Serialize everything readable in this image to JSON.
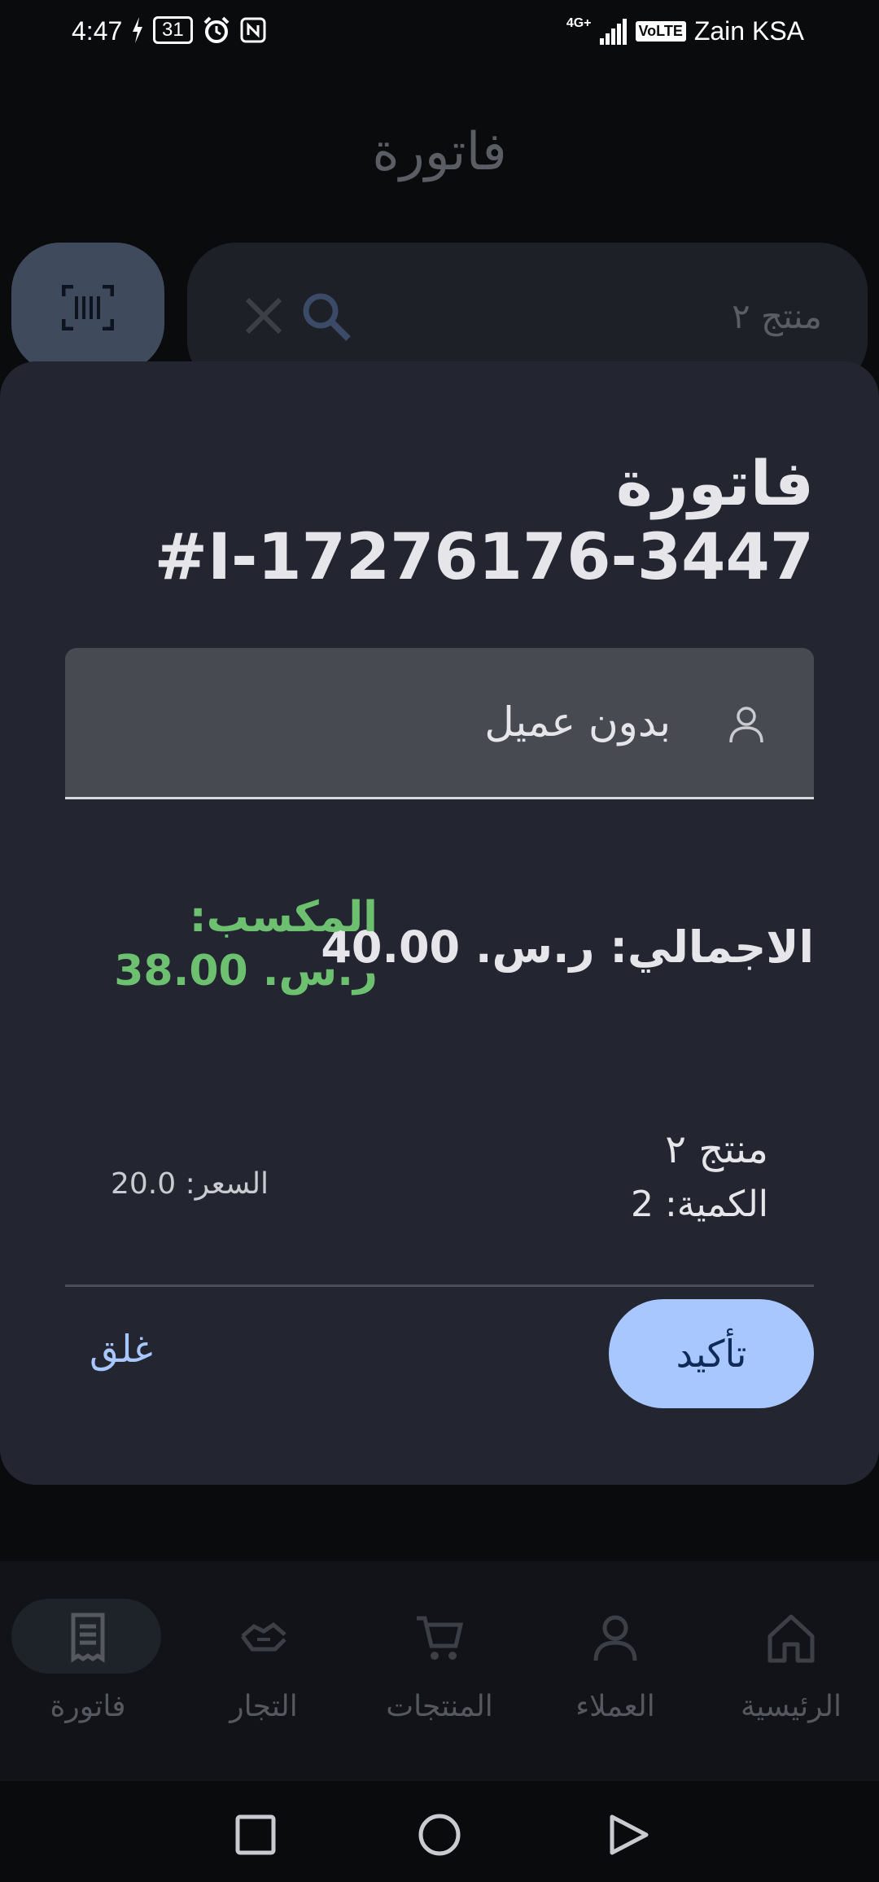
{
  "status_bar": {
    "time": "4:47",
    "battery": "31",
    "network": "4G+",
    "volte": "VoLTE",
    "carrier": "Zain KSA"
  },
  "app": {
    "title": "فاتورة",
    "search": {
      "value": "منتج ٢"
    }
  },
  "dialog": {
    "title": "فاتورة",
    "invoice_number": "#I-17276176-3447",
    "customer": "بدون عميل",
    "total_label": "الاجمالي: ر.س. 40.00",
    "profit_label": "المكسب:",
    "profit_value": "ر.س. 38.00",
    "profit_color": "#6cc070",
    "item": {
      "name": "منتج ٢",
      "quantity": "الكمية: 2",
      "price": "السعر: 20.0"
    },
    "confirm_label": "تأكيد",
    "close_label": "غلق"
  },
  "bottom_nav": {
    "items": [
      {
        "label": "فاتورة",
        "icon": "receipt-icon",
        "active": true
      },
      {
        "label": "التجار",
        "icon": "handshake-icon",
        "active": false
      },
      {
        "label": "المنتجات",
        "icon": "cart-icon",
        "active": false
      },
      {
        "label": "العملاء",
        "icon": "person-icon",
        "active": false
      },
      {
        "label": "الرئيسية",
        "icon": "home-icon",
        "active": false
      }
    ]
  }
}
